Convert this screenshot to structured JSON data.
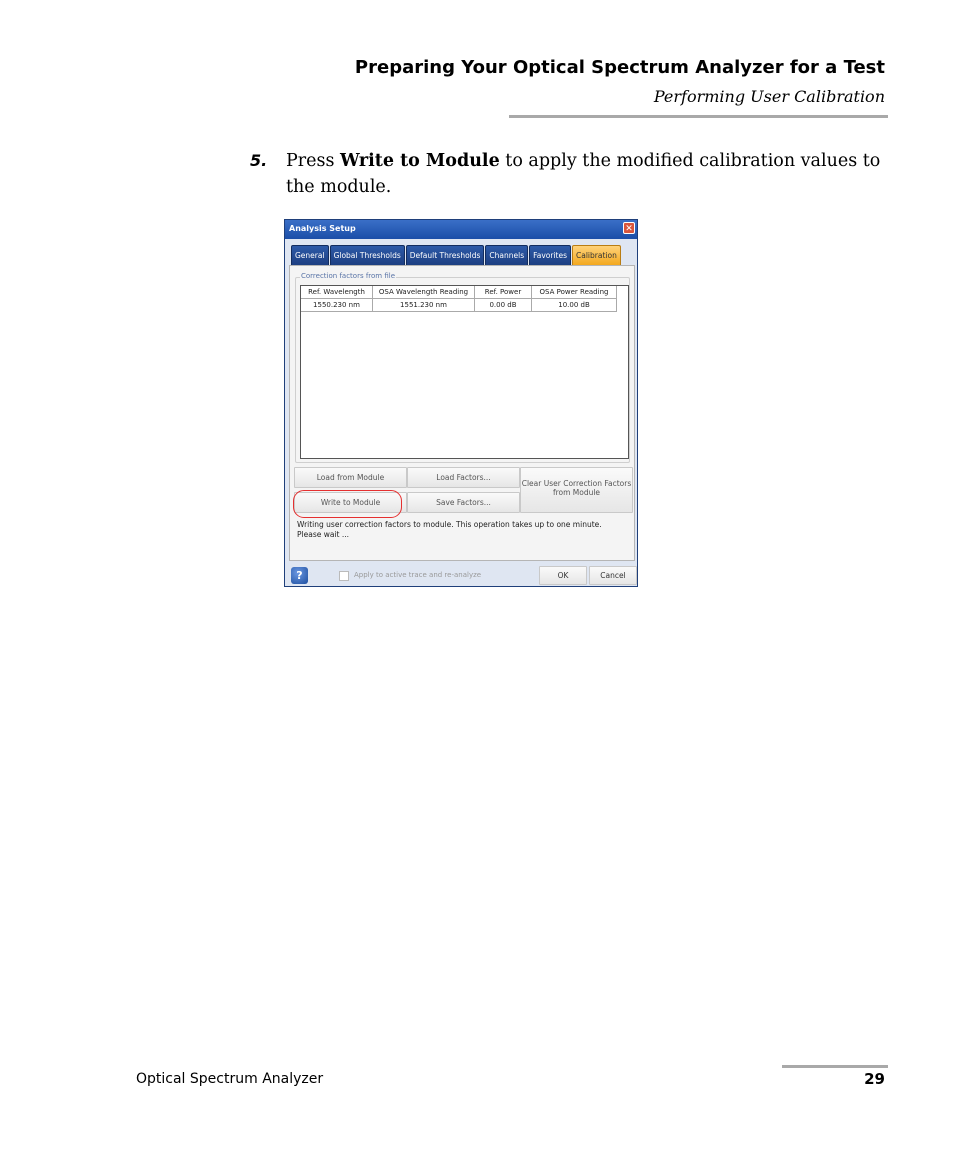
{
  "header": {
    "title": "Preparing Your Optical Spectrum Analyzer for a Test",
    "subtitle": "Performing User Calibration"
  },
  "step": {
    "number": "5.",
    "text_before": "Press ",
    "emphasis": "Write to Module",
    "text_after": " to apply the modified calibration values to the module."
  },
  "dialog": {
    "title": "Analysis Setup",
    "close": "✕",
    "tabs": [
      "General",
      "Global Thresholds",
      "Default Thresholds",
      "Channels",
      "Favorites",
      "Calibration"
    ],
    "active_tab": "Calibration",
    "group_label": "Correction factors from file",
    "table": {
      "columns": [
        "Ref. Wavelength",
        "OSA Wavelength Reading",
        "Ref. Power",
        "OSA Power Reading"
      ],
      "rows": [
        [
          "1550.230 nm",
          "1551.230 nm",
          "0.00 dB",
          "10.00 dB"
        ]
      ]
    },
    "buttons": {
      "load_from_module": "Load from Module",
      "load_factors": "Load Factors...",
      "clear": "Clear User Correction Factors from Module",
      "write_to_module": "Write to Module",
      "save_factors": "Save Factors..."
    },
    "status": "Writing user correction factors to module. This operation takes up to one minute. Please wait ...",
    "help": "?",
    "apply_label": "Apply to active trace and re-analyze",
    "ok": "OK",
    "cancel": "Cancel"
  },
  "footer": {
    "product": "Optical Spectrum Analyzer",
    "page": "29"
  }
}
